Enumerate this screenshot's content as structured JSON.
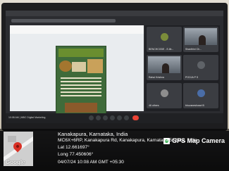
{
  "screen": {
    "tiles": [
      {
        "name": "BENCHCODE - E-lib..."
      },
      {
        "name": "Shanthini Ch..."
      },
      {
        "name": "Rahul Krishna"
      },
      {
        "name": "POOJA P S"
      },
      {
        "name": "46 others"
      },
      {
        "name": "bhuvaneshwari B"
      }
    ],
    "meeting_label": "10:08 AM | MBC Digital Marketing"
  },
  "gps_stamp": {
    "app_label": "GPS Map Camera",
    "map_label": "Google",
    "location_title": "Kanakapura, Karnataka, India",
    "address": "MC6X+6RP, Kanakapura Rd, Kanakapura, Karnataka 562112, India",
    "latitude": "Lat 12.661697°",
    "longitude": "Long 77.450606°",
    "datetime": "04/07/24 10:08 AM GMT +05:30"
  },
  "colors": {
    "overlay": "#000000",
    "accent_green": "#27a844",
    "pin_red": "#d93025"
  }
}
